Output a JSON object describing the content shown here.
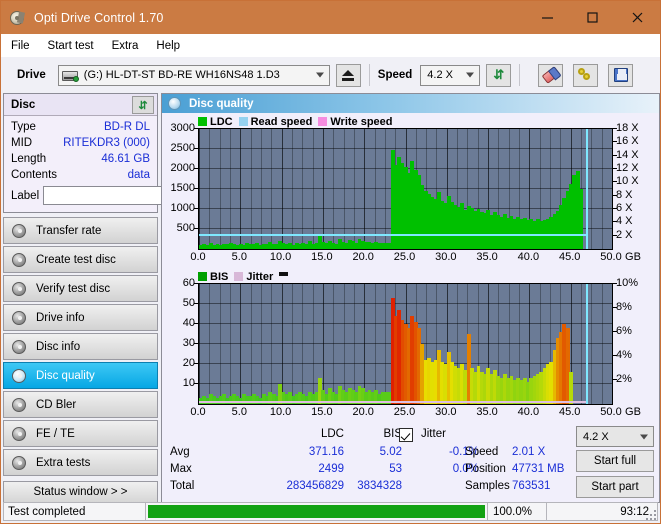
{
  "window": {
    "title": "Opti Drive Control 1.70",
    "title_icon": "disc-drive-icon",
    "minimize": "–",
    "maximize": "□",
    "close": "✕",
    "accent_color": "#cb7b43"
  },
  "menubar": {
    "items": [
      "File",
      "Start test",
      "Extra",
      "Help"
    ]
  },
  "toolbar": {
    "drive_label": "Drive",
    "drive_value": "(G:)  HL-DT-ST BD-RE  WH16NS48 1.D3",
    "eject_icon": "eject-icon",
    "speed_label": "Speed",
    "speed_value": "4.2 X",
    "refresh_icon": "refresh-icon",
    "eraser_icon": "eraser-icon",
    "keys_icon": "keys-icon",
    "save_icon": "floppy-save-icon"
  },
  "disc_panel": {
    "title": "Disc",
    "refresh_icon": "refresh-disc-icon",
    "rows": [
      {
        "key": "Type",
        "value": "BD-R DL"
      },
      {
        "key": "MID",
        "value": "RITEKDR3 (000)"
      },
      {
        "key": "Length",
        "value": "46.61 GB"
      },
      {
        "key": "Contents",
        "value": "data"
      }
    ],
    "label_key": "Label",
    "label_value": "",
    "label_button_icon": "disc-label-icon"
  },
  "sidebar": {
    "items": [
      {
        "label": "Transfer rate",
        "active": false
      },
      {
        "label": "Create test disc",
        "active": false
      },
      {
        "label": "Verify test disc",
        "active": false
      },
      {
        "label": "Drive info",
        "active": false
      },
      {
        "label": "Disc info",
        "active": false
      },
      {
        "label": "Disc quality",
        "active": true
      },
      {
        "label": "CD Bler",
        "active": false
      },
      {
        "label": "FE / TE",
        "active": false
      },
      {
        "label": "Extra tests",
        "active": false
      }
    ],
    "status_window": "Status window > >"
  },
  "panel": {
    "title": "Disc quality",
    "icon": "disc-quality-icon"
  },
  "stats": {
    "col_ldc": "LDC",
    "col_bis": "BIS",
    "row_avg": "Avg",
    "row_max": "Max",
    "row_total": "Total",
    "avg_ldc": "371.16",
    "avg_bis": "5.02",
    "max_ldc": "2499",
    "max_bis": "53",
    "total_ldc": "283456829",
    "total_bis": "3834328",
    "jitter_label": "Jitter",
    "jitter_checked": true,
    "jitter_avg": "-0.1%",
    "jitter_max": "0.0%",
    "speed_label": "Speed",
    "speed_value": "2.01 X",
    "position_label": "Position",
    "position_value": "47731 MB",
    "samples_label": "Samples",
    "samples_value": "763531",
    "speed_select": "4.2 X",
    "start_full": "Start full",
    "start_part": "Start part"
  },
  "statusbar": {
    "message": "Test completed",
    "percent": "100.0%",
    "progress": 100,
    "elapsed": "93:12"
  },
  "chart_data": [
    {
      "type": "area",
      "name": "ldc-chart",
      "title": "",
      "legend": [
        {
          "label": "LDC",
          "color": "#00c000"
        },
        {
          "label": "Read speed",
          "color": "#96d2f0"
        },
        {
          "label": "Write speed",
          "color": "#f58ce0"
        }
      ],
      "legend_position": "top-left",
      "xlabel": "GB",
      "ylabel": "",
      "xlim": [
        0,
        50
      ],
      "ylim": [
        0,
        3000
      ],
      "y2lim": [
        0,
        18
      ],
      "y2label": "X",
      "yticks": [
        500,
        1000,
        1500,
        2000,
        2500,
        3000
      ],
      "y2ticks": [
        "2 X",
        "4 X",
        "6 X",
        "8 X",
        "10 X",
        "12 X",
        "14 X",
        "16 X",
        "18 X"
      ],
      "xticks": [
        "0.0",
        "5.0",
        "10.0",
        "15.0",
        "20.0",
        "25.0",
        "30.0",
        "35.0",
        "40.0",
        "45.0",
        "50.0"
      ],
      "grid": true,
      "read_speed_line_x_value": 2.01,
      "read_speed_end_gb": 46.9,
      "series": [
        {
          "name": "LDC",
          "color": "#00c000",
          "x": [
            0.2,
            0.6,
            1.0,
            1.4,
            1.8,
            2.2,
            2.6,
            3.0,
            3.4,
            3.8,
            4.2,
            4.6,
            5.0,
            5.4,
            5.8,
            6.2,
            6.6,
            7.0,
            7.4,
            7.8,
            8.2,
            8.6,
            9.0,
            9.4,
            9.8,
            10.2,
            10.6,
            11.0,
            11.4,
            11.8,
            12.2,
            12.6,
            13.0,
            13.4,
            13.8,
            14.2,
            14.6,
            15.0,
            15.4,
            15.8,
            16.2,
            16.6,
            17.0,
            17.4,
            17.8,
            18.2,
            18.6,
            19.0,
            19.4,
            19.8,
            20.2,
            20.6,
            21.0,
            21.4,
            21.8,
            22.2,
            22.6,
            23.0,
            23.4,
            23.8,
            24.2,
            24.6,
            25.0,
            25.4,
            25.8,
            26.2,
            26.6,
            27.0,
            27.4,
            27.8,
            28.2,
            28.6,
            29.0,
            29.4,
            29.8,
            30.2,
            30.6,
            31.0,
            31.4,
            31.8,
            32.2,
            32.6,
            33.0,
            33.4,
            33.8,
            34.2,
            34.6,
            35.0,
            35.4,
            35.8,
            36.2,
            36.6,
            37.0,
            37.4,
            37.8,
            38.2,
            38.6,
            39.0,
            39.4,
            39.8,
            40.2,
            40.6,
            41.0,
            41.4,
            41.8,
            42.2,
            42.6,
            43.0,
            43.4,
            43.8,
            44.2,
            44.6,
            45.0,
            45.4,
            45.8,
            46.2,
            46.6,
            46.9
          ],
          "values": [
            95,
            120,
            105,
            140,
            110,
            125,
            100,
            135,
            115,
            150,
            120,
            110,
            130,
            105,
            160,
            120,
            115,
            145,
            110,
            130,
            120,
            175,
            135,
            115,
            190,
            150,
            120,
            140,
            110,
            160,
            125,
            145,
            115,
            195,
            130,
            150,
            330,
            180,
            140,
            200,
            155,
            130,
            260,
            180,
            145,
            215,
            190,
            160,
            240,
            200,
            170,
            185,
            150,
            170,
            145,
            160,
            150,
            155,
            2480,
            2100,
            2300,
            2150,
            2050,
            1900,
            2200,
            1980,
            1850,
            1600,
            1450,
            1380,
            1300,
            1250,
            1420,
            1200,
            1150,
            1320,
            1180,
            1100,
            1050,
            1150,
            980,
            1080,
            1020,
            950,
            1000,
            930,
            890,
            980,
            860,
            920,
            840,
            800,
            870,
            780,
            820,
            760,
            800,
            740,
            780,
            720,
            760,
            700,
            740,
            690,
            720,
            760,
            800,
            880,
            950,
            1100,
            1280,
            1450,
            1620,
            1850,
            1950,
            1500
          ]
        }
      ]
    },
    {
      "type": "area",
      "name": "bis-chart",
      "title": "",
      "legend": [
        {
          "label": "BIS",
          "color": "#00a000"
        },
        {
          "label": "Jitter",
          "color": "#d8b8d8"
        }
      ],
      "legend_position": "top-left",
      "xlabel": "GB",
      "ylabel": "",
      "xlim": [
        0,
        50
      ],
      "ylim": [
        0,
        60
      ],
      "y2lim": [
        0,
        10
      ],
      "y2label": "%",
      "yticks": [
        10,
        20,
        30,
        40,
        50,
        60
      ],
      "y2ticks": [
        "2%",
        "4%",
        "6%",
        "8%",
        "10%"
      ],
      "xticks": [
        "0.0",
        "5.0",
        "10.0",
        "15.0",
        "20.0",
        "25.0",
        "30.0",
        "35.0",
        "40.0",
        "45.0",
        "50.0"
      ],
      "grid": true,
      "read_speed_end_gb": 46.9,
      "series": [
        {
          "name": "BIS",
          "color_low": "#22c422",
          "color_mid": "#e8e000",
          "color_high": "#e02000",
          "x": [
            0.2,
            0.6,
            1.0,
            1.4,
            1.8,
            2.2,
            2.6,
            3.0,
            3.4,
            3.8,
            4.2,
            4.6,
            5.0,
            5.4,
            5.8,
            6.2,
            6.6,
            7.0,
            7.4,
            7.8,
            8.2,
            8.6,
            9.0,
            9.4,
            9.8,
            10.2,
            10.6,
            11.0,
            11.4,
            11.8,
            12.2,
            12.6,
            13.0,
            13.4,
            13.8,
            14.2,
            14.6,
            15.0,
            15.4,
            15.8,
            16.2,
            16.6,
            17.0,
            17.4,
            17.8,
            18.2,
            18.6,
            19.0,
            19.4,
            19.8,
            20.2,
            20.6,
            21.0,
            21.4,
            21.8,
            22.2,
            22.6,
            23.0,
            23.4,
            23.8,
            24.2,
            24.6,
            25.0,
            25.4,
            25.8,
            26.2,
            26.6,
            27.0,
            27.4,
            27.8,
            28.2,
            28.6,
            29.0,
            29.4,
            29.8,
            30.2,
            30.6,
            31.0,
            31.4,
            31.8,
            32.2,
            32.6,
            33.0,
            33.4,
            33.8,
            34.2,
            34.6,
            35.0,
            35.4,
            35.8,
            36.2,
            36.6,
            37.0,
            37.4,
            37.8,
            38.2,
            38.6,
            39.0,
            39.4,
            39.8,
            40.2,
            40.6,
            41.0,
            41.4,
            41.8,
            42.2,
            42.6,
            43.0,
            43.4,
            43.8,
            44.2,
            44.6,
            45.0,
            45.4,
            45.8,
            46.2,
            46.6,
            46.9
          ],
          "values": [
            3,
            4,
            3,
            5,
            4,
            3,
            4,
            5,
            3,
            4,
            5,
            4,
            3,
            5,
            4,
            4,
            5,
            4,
            3,
            5,
            4,
            6,
            5,
            4,
            10,
            6,
            5,
            6,
            4,
            5,
            6,
            5,
            4,
            6,
            5,
            6,
            13,
            7,
            5,
            8,
            6,
            5,
            9,
            7,
            6,
            8,
            7,
            6,
            9,
            8,
            6,
            7,
            6,
            7,
            5,
            6,
            6,
            6,
            53,
            44,
            47,
            42,
            40,
            38,
            44,
            41,
            38,
            30,
            22,
            23,
            21,
            22,
            27,
            21,
            20,
            26,
            21,
            19,
            18,
            20,
            17,
            35,
            18,
            16,
            19,
            16,
            15,
            18,
            15,
            17,
            14,
            13,
            15,
            13,
            14,
            12,
            13,
            12,
            13,
            11,
            13,
            14,
            15,
            16,
            18,
            20,
            21,
            27,
            33,
            36,
            40,
            38,
            16
          ]
        }
      ]
    }
  ]
}
